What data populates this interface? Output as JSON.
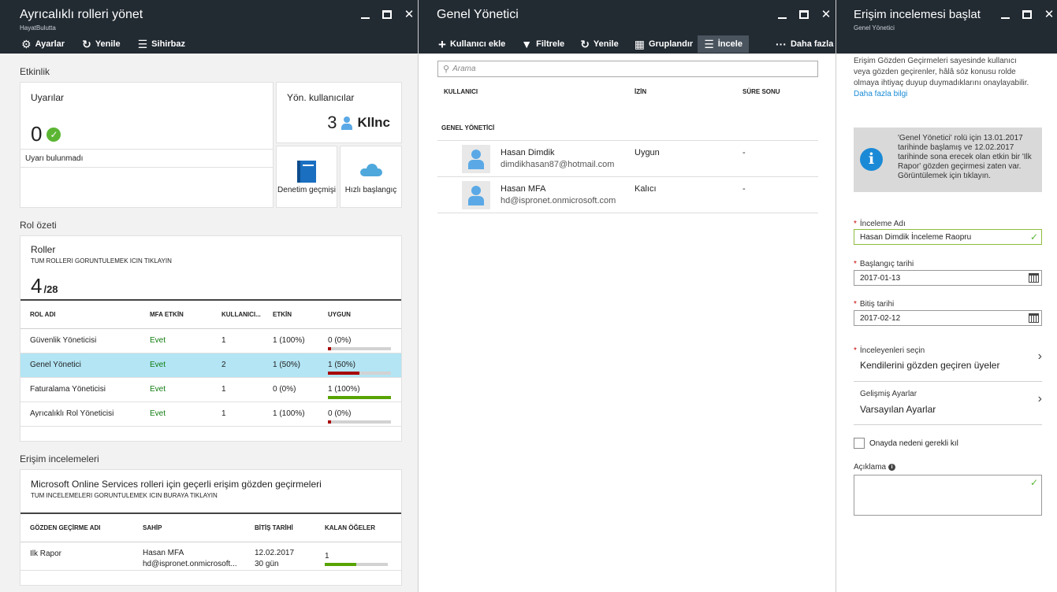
{
  "blade1": {
    "title": "Ayrıcalıklı rolleri yönet",
    "subtitle": "HayatBulutta",
    "toolbar": {
      "settings": "Ayarlar",
      "refresh": "Yenile",
      "wizard": "Sihirbaz"
    },
    "activity": {
      "section_label": "Etkinlik",
      "alerts_title": "Uyarılar",
      "alerts_count": "0",
      "alerts_status": "Uyarı bulunmadı",
      "admins_title": "Yön. kullanıcılar",
      "admins_count": "3",
      "admins_unit": "Kllnc",
      "audit_label": "Denetim geçmişi",
      "quickstart_label": "Hızlı başlangıç"
    },
    "roles": {
      "section_label": "Rol özeti",
      "title": "Roller",
      "subtitle": "TUM ROLLERI GORUNTULEMEK ICIN TIKLAYIN",
      "count": "4",
      "total": "/28",
      "columns": [
        "ROL ADI",
        "MFA ETKİN",
        "KULLANICI...",
        "ETKİN",
        "UYGUN"
      ],
      "rows": [
        {
          "name": "Güvenlik Yöneticisi",
          "mfa": "Evet",
          "users": "1",
          "active": "1 (100%)",
          "eligible": "0 (0%)",
          "eligible_fraction": 0.05,
          "bar_color": "#a80000",
          "selected": false
        },
        {
          "name": "Genel Yönetici",
          "mfa": "Evet",
          "users": "2",
          "active": "1 (50%)",
          "eligible": "1 (50%)",
          "eligible_fraction": 0.5,
          "bar_color": "#a80000",
          "selected": true
        },
        {
          "name": "Faturalama Yöneticisi",
          "mfa": "Evet",
          "users": "1",
          "active": "0 (0%)",
          "eligible": "1 (100%)",
          "eligible_fraction": 1.0,
          "bar_color": "#57a300",
          "selected": false
        },
        {
          "name": "Ayrıcalıklı Rol Yöneticisi",
          "mfa": "Evet",
          "users": "1",
          "active": "1 (100%)",
          "eligible": "0 (0%)",
          "eligible_fraction": 0.05,
          "bar_color": "#a80000",
          "selected": false
        }
      ]
    },
    "reviews": {
      "section_label": "Erişim incelemeleri",
      "title": "Microsoft Online Services rolleri için geçerli erişim gözden geçirmeleri",
      "subtitle": "TUM INCELEMELERI GORUNTULEMEK ICIN BURAYA TIKLAYIN",
      "columns": [
        "GÖZDEN GEÇİRME ADI",
        "SAHİP",
        "BİTİŞ TARİHİ",
        "KALAN ÖĞELER"
      ],
      "rows": [
        {
          "name": "Ilk Rapor",
          "owner": "Hasan MFA",
          "owner_email": "hd@ispronet.onmicrosoft...",
          "end_date": "12.02.2017",
          "remaining_days": "30 gün",
          "remaining": "1",
          "remaining_fraction": 0.5
        }
      ]
    }
  },
  "blade2": {
    "title": "Genel Yönetici",
    "toolbar": {
      "add_user": "Kullanıcı ekle",
      "filter": "Filtrele",
      "refresh": "Yenile",
      "group": "Gruplandır",
      "review": "İncele",
      "more": "Daha fazla"
    },
    "search_placeholder": "Arama",
    "columns": [
      "KULLANICI",
      "İZİN",
      "SÜRE SONU"
    ],
    "group_label": "GENEL YÖNETİCİ",
    "users": [
      {
        "name": "Hasan Dimdik",
        "email": "dimdikhasan87@hotmail.com",
        "permission": "Uygun",
        "expires": "-"
      },
      {
        "name": "Hasan MFA",
        "email": "hd@ispronet.onmicrosoft.com",
        "permission": "Kalıcı",
        "expires": "-"
      }
    ]
  },
  "blade3": {
    "title": "Erişim incelemesi başlat",
    "subtitle": "Genel Yönetici",
    "intro": "Erişim Gözden Geçirmeleri sayesinde kullanıcı veya gözden geçirenler, hâlâ söz konusu rolde olmaya ihtiyaç duyup duymadıklarını onaylayabilir.",
    "more_link": "Daha fazla bilgi",
    "info_text": "'Genel Yönetici' rolü için 13.01.2017 tarihinde başlamış ve 12.02.2017 tarihinde sona erecek olan etkin bir 'Ilk Rapor' gözden geçirmesi zaten var. Görüntülemek için tıklayın.",
    "review_name_label": "İnceleme Adı",
    "review_name_value": "Hasan Dimdik İnceleme Raopru",
    "start_label": "Başlangıç tarihi",
    "start_value": "2017-01-13",
    "end_label": "Bitiş tarihi",
    "end_value": "2017-02-12",
    "reviewers_label": "İnceleyenleri seçin",
    "reviewers_value": "Kendilerini gözden geçiren üyeler",
    "advanced_label": "Gelişmiş Ayarlar",
    "advanced_value": "Varsayılan Ayarlar",
    "approval_checkbox_label": "Onayda nedeni gerekli kıl",
    "description_label": "Açıklama"
  },
  "colors": {
    "header": "#222a32",
    "accent": "#1a8bd6",
    "selected_row": "#b3e5f4",
    "success": "#57a300",
    "danger": "#a80000"
  },
  "icons": [
    "gear-icon",
    "refresh-icon",
    "wizard-icon",
    "plus-icon",
    "filter-icon",
    "group-icon",
    "review-icon",
    "more-icon",
    "check-circle-icon",
    "user-icon",
    "book-icon",
    "cloud-icon",
    "info-icon",
    "calendar-icon",
    "chevron-right-icon",
    "minimize-icon",
    "maximize-icon",
    "close-icon"
  ]
}
